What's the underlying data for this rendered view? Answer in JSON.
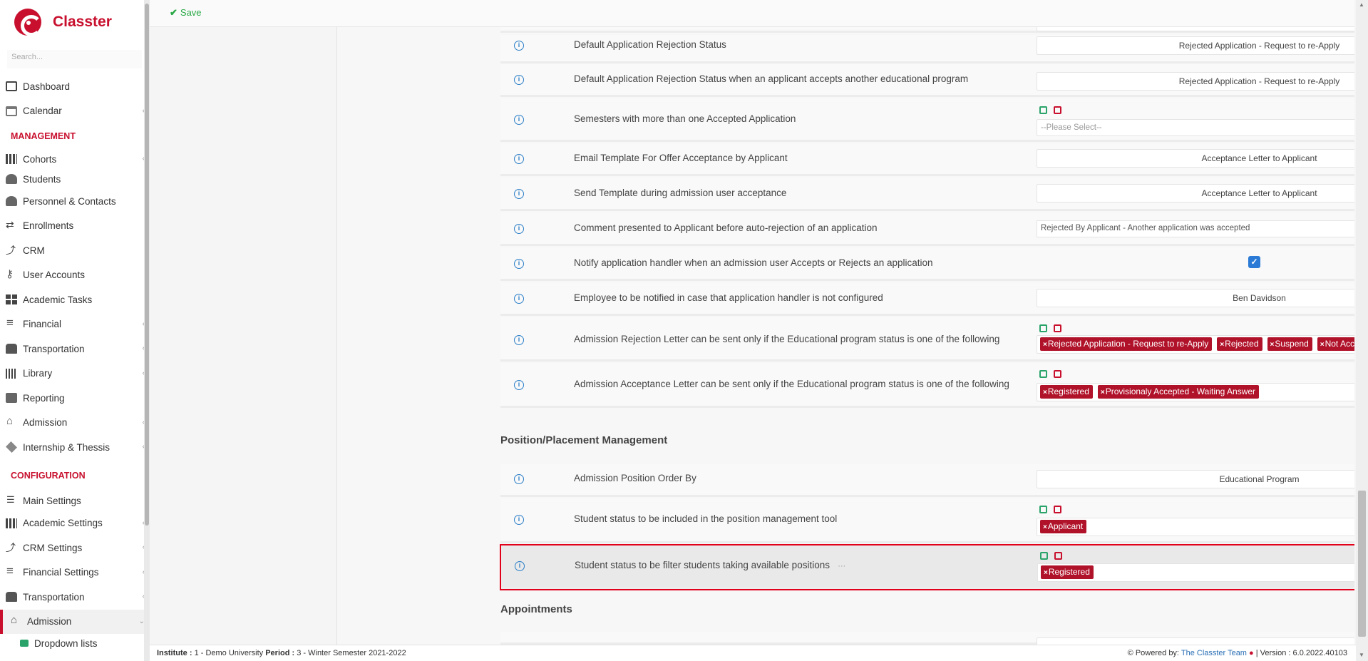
{
  "app": {
    "brand": "Classter",
    "search_placeholder": "Search..."
  },
  "toolbar": {
    "save_label": "Save"
  },
  "sidebar": {
    "items_top": [
      {
        "label": "Dashboard",
        "icon": "monitor-icon"
      },
      {
        "label": "Calendar",
        "icon": "calendar-icon"
      }
    ],
    "section_management": "MANAGEMENT",
    "items_management": [
      {
        "label": "Cohorts",
        "icon": "cohorts-icon"
      },
      {
        "label": "Students",
        "icon": "students-icon"
      },
      {
        "label": "Personnel & Contacts",
        "icon": "personnel-icon"
      },
      {
        "label": "Enrollments",
        "icon": "enrollments-icon"
      },
      {
        "label": "CRM",
        "icon": "crm-icon"
      },
      {
        "label": "User Accounts",
        "icon": "key-icon"
      },
      {
        "label": "Academic Tasks",
        "icon": "tiles-icon"
      },
      {
        "label": "Financial",
        "icon": "coins-icon"
      },
      {
        "label": "Transportation",
        "icon": "bus-icon"
      },
      {
        "label": "Library",
        "icon": "books-icon"
      },
      {
        "label": "Reporting",
        "icon": "printer-icon"
      },
      {
        "label": "Admission",
        "icon": "bank-icon"
      },
      {
        "label": "Internship & Thessis",
        "icon": "cube-icon"
      }
    ],
    "section_configuration": "CONFIGURATION",
    "items_configuration": [
      {
        "label": "Main Settings",
        "icon": "sliders-icon"
      },
      {
        "label": "Academic Settings",
        "icon": "cohorts-icon"
      },
      {
        "label": "CRM Settings",
        "icon": "crm-icon"
      },
      {
        "label": "Financial Settings",
        "icon": "coins-icon"
      },
      {
        "label": "Transportation",
        "icon": "bus-icon"
      },
      {
        "label": "Admission",
        "icon": "bank-icon"
      },
      {
        "label": "Dropdown lists",
        "icon": "layers-icon"
      }
    ]
  },
  "settings": {
    "rows": [
      {
        "label": "Default Application Rejection Status",
        "value": "Rejected Application - Request to re-Apply"
      },
      {
        "label": "Default Application Rejection Status when an applicant accepts another educational program",
        "value": "Rejected Application - Request to re-Apply"
      },
      {
        "label": "Semesters with more than one Accepted Application",
        "placeholder": "--Please Select--"
      },
      {
        "label": "Email Template For Offer Acceptance by Applicant",
        "value": "Acceptance Letter to Applicant"
      },
      {
        "label": "Send Template during admission user acceptance",
        "value": "Acceptance Letter to Applicant"
      },
      {
        "label": "Comment presented to Applicant before auto-rejection of an application",
        "value": "Rejected By Applicant - Another application was accepted"
      },
      {
        "label": "Notify application handler when an admission user Accepts or Rejects an application",
        "checked": true
      },
      {
        "label": "Employee to be notified in case that application handler is not configured",
        "value": "Ben Davidson"
      },
      {
        "label": "Admission Rejection Letter can be sent only if the Educational program status is one of the following",
        "tags": [
          "Rejected Application - Request to re-Apply",
          "Rejected",
          "Suspend",
          "Not Accepted"
        ]
      },
      {
        "label": "Admission Acceptance Letter can be sent only if the Educational program status is one of the following",
        "tags": [
          "Registered",
          "Provisionaly Accepted - Waiting Answer"
        ]
      }
    ],
    "section_position": "Position/Placement Management",
    "position_rows": [
      {
        "label": "Admission Position Order By",
        "value": "Educational Program"
      },
      {
        "label": "Student status to be included in the position management tool",
        "tags": [
          "Applicant"
        ]
      },
      {
        "label": "Student status to be filter students taking available positions",
        "tags": [
          "Registered"
        ],
        "ellipsis": "···"
      }
    ],
    "section_appointments": "Appointments"
  },
  "footer": {
    "institute_label": "Institute :",
    "institute_value": "1 - Demo University",
    "period_label": "Period :",
    "period_value": "3 - Winter Semester 2021-2022",
    "powered_by": "Powered by:",
    "team": "The Classter Team",
    "version": "| Version : 6.0.2022.40103"
  },
  "colors": {
    "accent": "#c8102e",
    "tag": "#b0122a",
    "link": "#2a7ec7",
    "save": "#27a844",
    "highlight_border": "#e2001a"
  }
}
